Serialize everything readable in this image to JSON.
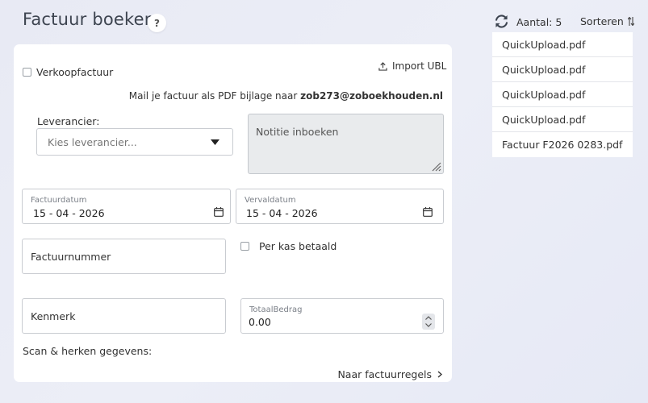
{
  "header": {
    "title": "Factuur boeken",
    "help_label": "?"
  },
  "form": {
    "sales_invoice_label": "Verkoopfactuur",
    "import_ubl_label": "Import UBL",
    "mail_info_prefix": "Mail je factuur als PDF bijlage naar ",
    "mail_info_email": "zob273@zoboekhouden.nl",
    "supplier_label": "Leverancier:",
    "supplier_placeholder": "Kies leverancier...",
    "note_placeholder": "Notitie inboeken",
    "invoice_date_label": "Factuurdatum",
    "invoice_date_value": "15 - 04 - 2026",
    "due_date_label": "Vervaldatum",
    "due_date_value": "15 - 04 - 2026",
    "invoice_number_placeholder": "Factuurnummer",
    "cash_paid_label": "Per kas betaald",
    "reference_placeholder": "Kenmerk",
    "total_amount_label": "TotaalBedrag",
    "total_amount_value": "0.00",
    "scan_label": "Scan & herken gegevens:",
    "next_link": "Naar factuurregels"
  },
  "sidebar": {
    "count_label": "Aantal: 5",
    "sort_label": "Sorteren",
    "files": [
      {
        "name": "QuickUpload.pdf"
      },
      {
        "name": "QuickUpload.pdf"
      },
      {
        "name": "QuickUpload.pdf"
      },
      {
        "name": "QuickUpload.pdf"
      },
      {
        "name": "Factuur F2026 0283.pdf"
      }
    ]
  },
  "icons": {
    "refresh": "refresh-icon",
    "sort": "sort-icon",
    "upload": "upload-icon",
    "calendar": "calendar-icon",
    "dropdown": "caret-down-icon",
    "chevron": "chevron-right-icon"
  }
}
